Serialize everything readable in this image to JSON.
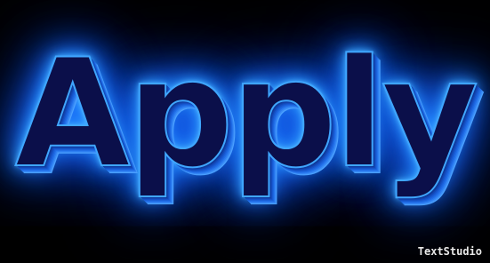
{
  "logo": {
    "word": "Apply"
  },
  "watermark": {
    "text": "TextStudio"
  },
  "colors": {
    "background": "#000000",
    "letter_fill": "#0b0f4a",
    "glow": "#3aa6ff",
    "extrusion": "#1552c8",
    "watermark": "#e8e8e8"
  }
}
